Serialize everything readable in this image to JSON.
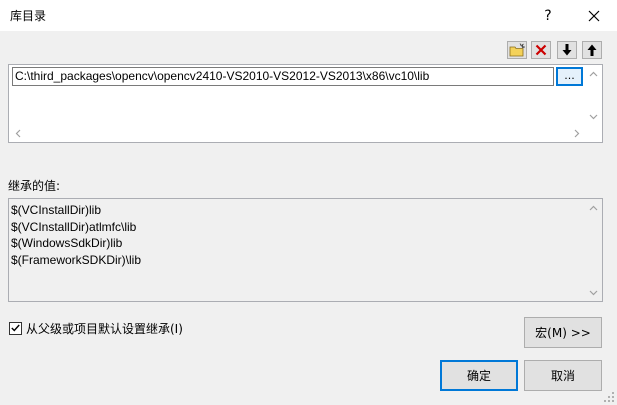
{
  "window": {
    "title": "库目录",
    "help_label": "?"
  },
  "directory_list": {
    "path_value": "C:\\third_packages\\opencv\\opencv2410-VS2010-VS2012-VS2013\\x86\\vc10\\lib",
    "browse_label": "..."
  },
  "inherited": {
    "label": "继承的值:",
    "values": [
      "$(VCInstallDir)lib",
      "$(VCInstallDir)atlmfc\\lib",
      "$(WindowsSdkDir)lib",
      "$(FrameworkSDKDir)\\lib"
    ]
  },
  "inherit_checkbox": {
    "label": "从父级或项目默认设置继承(I)",
    "checked": true
  },
  "buttons": {
    "macro": "宏(M) >>",
    "ok": "确定",
    "cancel": "取消"
  },
  "colors": {
    "accent": "#0078d7",
    "delete_red": "#cc0000",
    "folder_yellow": "#f4d25a"
  }
}
